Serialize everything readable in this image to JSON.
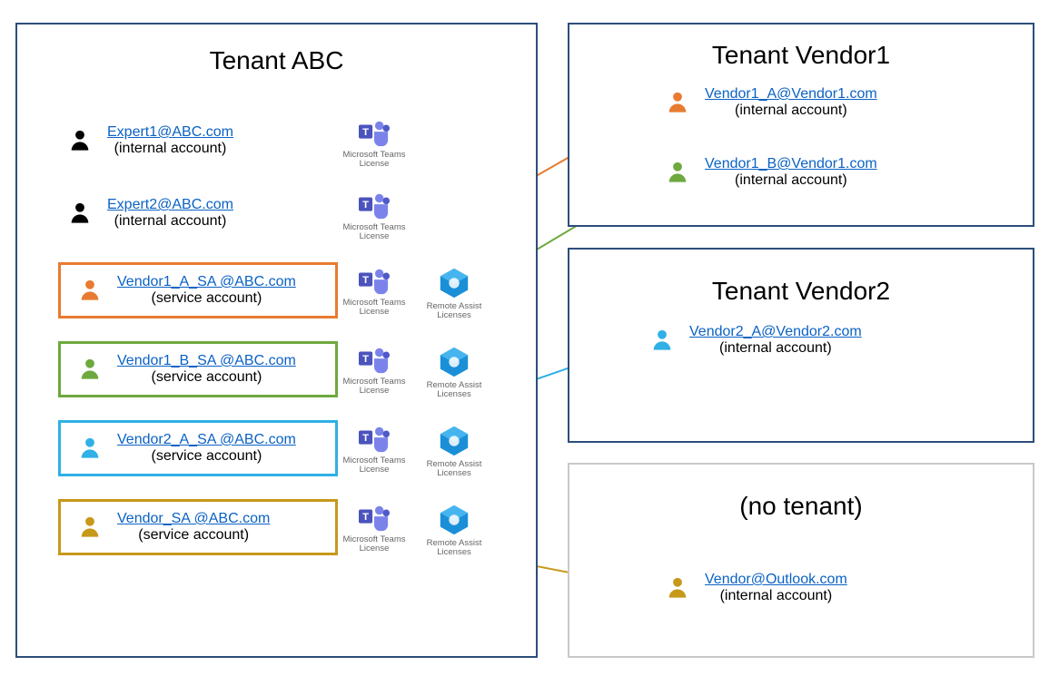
{
  "colors": {
    "orange": "#e87b31",
    "green": "#6ea93e",
    "blue": "#2fb0e6",
    "gold": "#c7991a",
    "black": "#000000",
    "boxNavy": "#2c4e7a",
    "boxGrey": "#c9c9c9"
  },
  "tenantABC": {
    "title": "Tenant ABC",
    "users": {
      "expert1": {
        "email": "Expert1@ABC.com",
        "sub": "(internal account)"
      },
      "expert2": {
        "email": "Expert2@ABC.com",
        "sub": "(internal account)"
      },
      "vendor1a": {
        "email": "Vendor1_A_SA @ABC.com",
        "sub": "(service account)"
      },
      "vendor1b": {
        "email": "Vendor1_B_SA @ABC.com",
        "sub": "(service account)"
      },
      "vendor2a": {
        "email": "Vendor2_A_SA @ABC.com",
        "sub": "(service account)"
      },
      "vendorx": {
        "email": "Vendor_SA @ABC.com",
        "sub": "(service account)"
      }
    }
  },
  "licenses": {
    "teams": "Microsoft Teams\nLicense",
    "remote": "Remote Assist\nLicenses"
  },
  "tenantV1": {
    "title": "Tenant Vendor1",
    "userA": {
      "email": "Vendor1_A@Vendor1.com",
      "sub": "(internal account)"
    },
    "userB": {
      "email": "Vendor1_B@Vendor1.com",
      "sub": "(internal account)"
    }
  },
  "tenantV2": {
    "title": "Tenant Vendor2",
    "userA": {
      "email": "Vendor2_A@Vendor2.com",
      "sub": "(internal account)"
    }
  },
  "noTenant": {
    "title": "(no tenant)",
    "user": {
      "email": "Vendor@Outlook.com",
      "sub": "(internal account)"
    }
  }
}
